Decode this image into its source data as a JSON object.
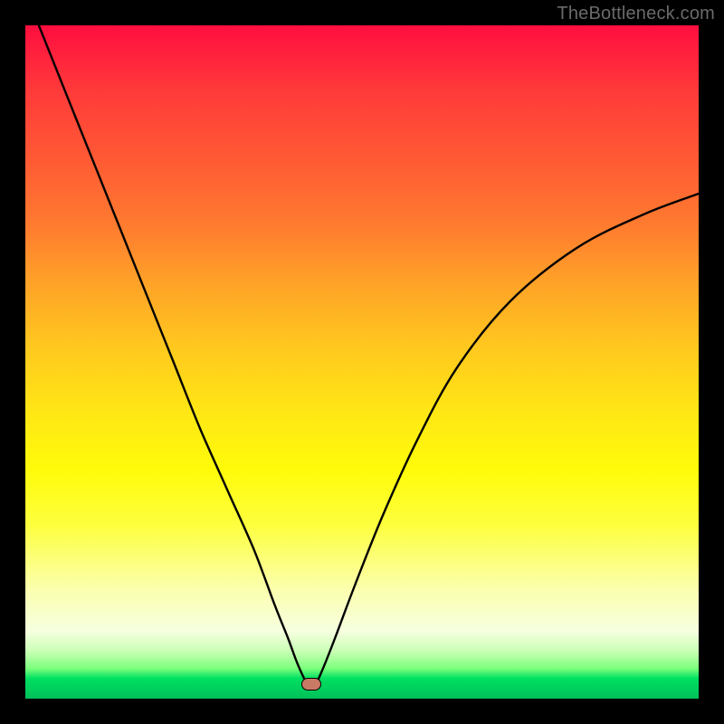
{
  "watermark": "TheBottleneck.com",
  "marker": {
    "x_pct": 42.5,
    "y_pct": 97.8
  },
  "colors": {
    "curve": "#000000",
    "marker_fill": "#c97a65",
    "marker_stroke": "#000000",
    "frame": "#000000"
  },
  "chart_data": {
    "type": "line",
    "title": "",
    "xlabel": "",
    "ylabel": "",
    "xlim": [
      0,
      100
    ],
    "ylim": [
      0,
      100
    ],
    "grid": false,
    "legend": false,
    "annotations": [
      "TheBottleneck.com"
    ],
    "series": [
      {
        "name": "bottleneck-curve",
        "x": [
          2,
          6,
          10,
          14,
          18,
          22,
          26,
          30,
          34,
          37,
          39,
          40.5,
          42,
          43,
          44,
          46,
          49,
          53,
          58,
          64,
          72,
          82,
          92,
          100
        ],
        "y": [
          100,
          90,
          80,
          70,
          60,
          50,
          40,
          31,
          22,
          14,
          9,
          5,
          2,
          2,
          4,
          9,
          17,
          27,
          38,
          49,
          59,
          67,
          72,
          75
        ]
      }
    ],
    "background_gradient": {
      "direction": "vertical",
      "stops": [
        {
          "pos": 0.0,
          "color": "#ff0e3f"
        },
        {
          "pos": 0.3,
          "color": "#ff7c2f"
        },
        {
          "pos": 0.58,
          "color": "#ffe814"
        },
        {
          "pos": 0.84,
          "color": "#fbffb0"
        },
        {
          "pos": 0.95,
          "color": "#7dff7d"
        },
        {
          "pos": 1.0,
          "color": "#00c05a"
        }
      ]
    },
    "marker": {
      "x": 42.5,
      "y": 2.2,
      "shape": "rounded-rect",
      "color": "#c97a65"
    }
  }
}
